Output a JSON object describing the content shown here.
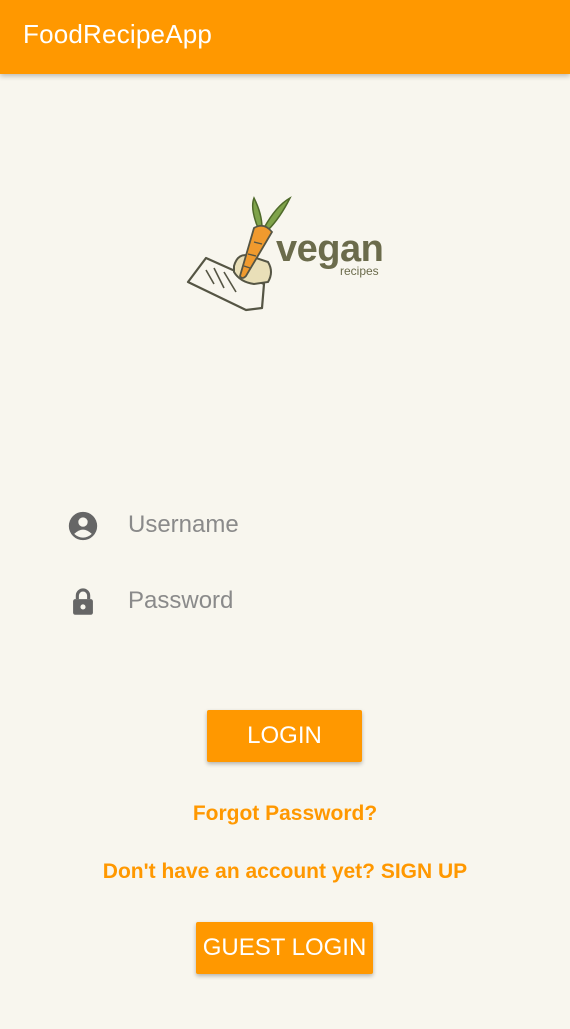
{
  "appbar": {
    "title": "FoodRecipeApp"
  },
  "logo": {
    "word": "vegan",
    "subtitle": "recipes",
    "icon": "carrot-notepad-logo"
  },
  "form": {
    "username": {
      "placeholder": "Username",
      "value": "",
      "icon": "account-circle-icon"
    },
    "password": {
      "placeholder": "Password",
      "value": "",
      "icon": "lock-icon"
    }
  },
  "buttons": {
    "login": "LOGIN",
    "guest_login": "GUEST LOGIN"
  },
  "links": {
    "forgot_password": "Forgot Password?",
    "signup": "Don't have an account yet? SIGN UP"
  },
  "colors": {
    "primary": "#FF9800",
    "background": "#F8F6EE",
    "icon": "#666666",
    "logo_text": "#6B6B4B"
  }
}
